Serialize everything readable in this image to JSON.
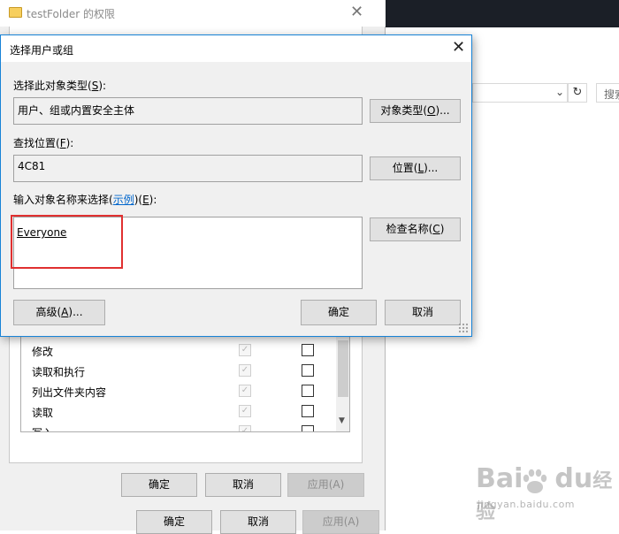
{
  "explorer": {
    "search_placeholder": "搜索",
    "refresh_glyph": "↻",
    "chevron_glyph": "⌄"
  },
  "properties_window": {
    "title": "testFolder 的权限",
    "close_glyph": "✕",
    "permissions": [
      {
        "label": "修改",
        "allow": true,
        "deny": false
      },
      {
        "label": "读取和执行",
        "allow": true,
        "deny": false
      },
      {
        "label": "列出文件夹内容",
        "allow": true,
        "deny": false
      },
      {
        "label": "读取",
        "allow": true,
        "deny": false
      },
      {
        "label": "写入",
        "allow": true,
        "deny": false
      }
    ],
    "inner_buttons": {
      "ok": "确定",
      "cancel": "取消",
      "apply": "应用(A)"
    },
    "outer_buttons": {
      "ok": "确定",
      "cancel": "取消",
      "apply": "应用(A)"
    }
  },
  "dialog": {
    "title": "选择用户或组",
    "close_glyph": "✕",
    "object_type": {
      "label_prefix": "选择此对象类型(",
      "label_key": "S",
      "label_suffix": "):",
      "value": "用户、组或内置安全主体",
      "button_prefix": "对象类型(",
      "button_key": "O",
      "button_suffix": ")..."
    },
    "location": {
      "label_prefix": "查找位置(",
      "label_key": "F",
      "label_suffix": "):",
      "value": "4C81",
      "button_prefix": "位置(",
      "button_key": "L",
      "button_suffix": ")..."
    },
    "names": {
      "label_prefix": "输入对象名称来选择(",
      "link_text": "示例",
      "label_mid": ")(",
      "label_key": "E",
      "label_suffix": "):",
      "value": "Everyone",
      "check_prefix": "检查名称(",
      "check_key": "C",
      "check_suffix": ")"
    },
    "advanced_prefix": "高级(",
    "advanced_key": "A",
    "advanced_suffix": ")...",
    "ok": "确定",
    "cancel": "取消"
  },
  "watermark": {
    "logo_left": "Bai",
    "logo_right": "du",
    "logo_cn": "经验",
    "url": "jingyan.baidu.com"
  }
}
